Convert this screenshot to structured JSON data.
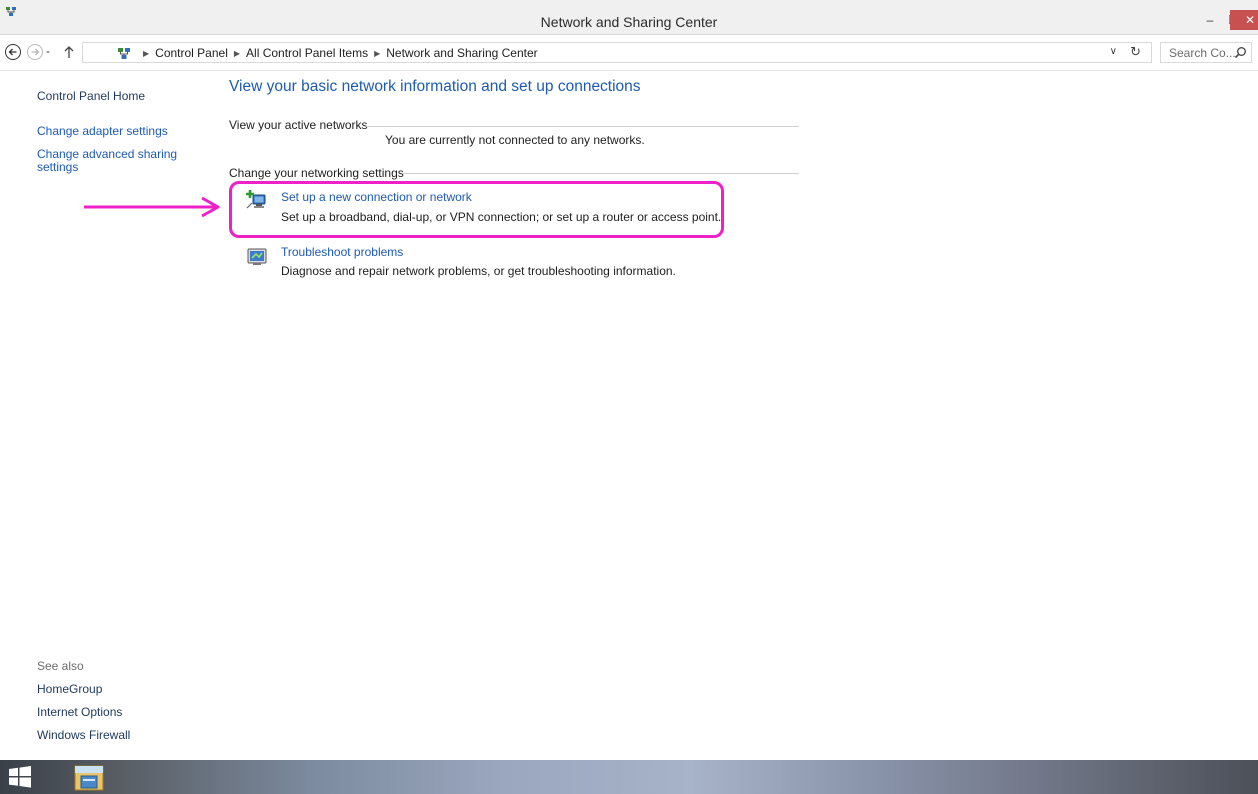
{
  "window": {
    "title": "Network and Sharing Center",
    "controls": {
      "minimize": "–",
      "restore": "❐",
      "close": "✕"
    }
  },
  "address_bar": {
    "breadcrumbs": [
      "Control Panel",
      "All Control Panel Items",
      "Network and Sharing Center"
    ],
    "search_placeholder": "Search Co..."
  },
  "left_pane": {
    "links": [
      "Control Panel Home",
      "Change adapter settings",
      "Change advanced sharing settings"
    ],
    "see_also_heading": "See also",
    "see_also_links": [
      "HomeGroup",
      "Internet Options",
      "Windows Firewall"
    ]
  },
  "main": {
    "title": "View your basic network information and set up connections",
    "active_networks_heading": "View your active networks",
    "not_connected_text": "You are currently not connected to any networks.",
    "change_settings_heading": "Change your networking settings",
    "tasks": [
      {
        "label": "Set up a new connection or network",
        "description": "Set up a broadband, dial-up, or VPN connection; or set up a router or access point.",
        "highlighted": true
      },
      {
        "label": "Troubleshoot problems",
        "description": "Diagnose and repair network problems, or get troubleshooting information."
      }
    ]
  },
  "annotation": {
    "color": "#f020c8"
  },
  "icons": [
    "network-icon",
    "back-arrow-icon",
    "forward-arrow-icon",
    "chevron-down-icon",
    "up-arrow-icon",
    "refresh-icon",
    "search-icon",
    "new-connection-icon",
    "troubleshoot-icon",
    "windows-start-icon",
    "file-explorer-icon"
  ]
}
